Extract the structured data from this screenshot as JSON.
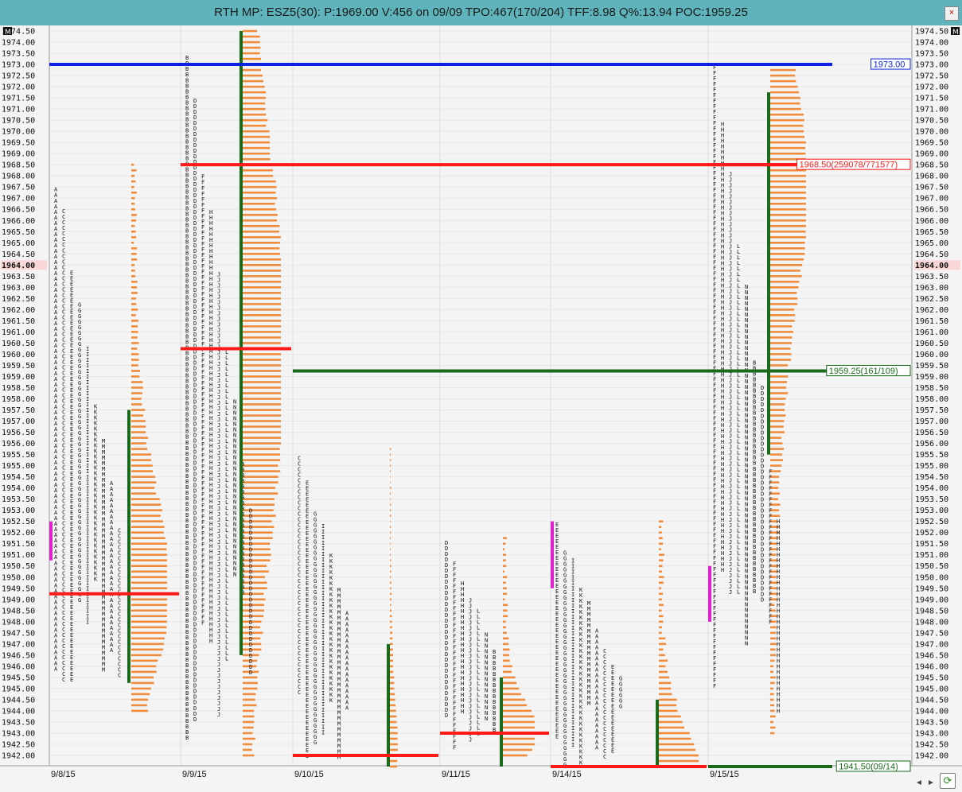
{
  "window": {
    "title": "RTH MP: ESZ5(30): P:1969.00 V:456 on 09/09 TPO:467(170/204) TFF:8.98 Q%:13.94 POC:1959.25",
    "close_label": "×",
    "corner_left": "M",
    "corner_right": "M"
  },
  "colors": {
    "profile": "#f08c3c",
    "poc": "#ff1a1a",
    "value_area": "#1a6a1a",
    "level_line": "#0a24e0",
    "initial_balance": "#dd22cc",
    "highlight_price_bg": "#f9d7d7"
  },
  "chart_data": {
    "type": "market_profile",
    "price_min": 1942.0,
    "price_max": 1974.5,
    "tick_size": 0.5,
    "highlight_price": 1964.0,
    "dates": [
      "9/8/15",
      "9/9/15",
      "9/10/15",
      "9/11/15",
      "9/14/15",
      "9/15/15"
    ],
    "sessions": [
      {
        "date": "9/8/15",
        "tpo_low": 1944.0,
        "tpo_high": 1968.5,
        "poc": 1949.25,
        "va_high": 1957.5,
        "va_low": 1945.25,
        "tpo_letters": [
          "A",
          "B",
          "C",
          "D",
          "E",
          "F",
          "G",
          "H",
          "I",
          "J",
          "K",
          "L",
          "M",
          "N"
        ],
        "ib_low": 1950.75,
        "ib_high": 1952.5
      },
      {
        "date": "9/9/15",
        "tpo_low": 1942.0,
        "tpo_high": 1974.5,
        "poc": 1960.25,
        "va_high": 1974.5,
        "va_low": 1946.5,
        "tpo_letters": [
          "A",
          "B",
          "C",
          "D",
          "E",
          "F",
          "G",
          "H",
          "I",
          "J",
          "K",
          "L",
          "M",
          "N"
        ]
      },
      {
        "date": "9/10/15",
        "tpo_low": 1941.5,
        "tpo_high": 1955.75,
        "poc": 1942.0,
        "va_high": 1947.0,
        "va_low": 1941.5,
        "tpo_letters": [
          "A",
          "B",
          "C",
          "D",
          "E",
          "F",
          "G",
          "H",
          "I",
          "J",
          "K",
          "L",
          "M",
          "N"
        ]
      },
      {
        "date": "9/11/15",
        "tpo_low": 1942.0,
        "tpo_high": 1951.75,
        "poc": 1943.0,
        "va_high": 1945.5,
        "va_low": 1941.5,
        "tpo_letters": [
          "A",
          "B",
          "C",
          "D",
          "E",
          "F",
          "G",
          "H",
          "I",
          "J",
          "K",
          "L",
          "M",
          "N"
        ]
      },
      {
        "date": "9/14/15",
        "tpo_low": 1941.5,
        "tpo_high": 1952.5,
        "poc": 1941.5,
        "va_high": 1944.5,
        "va_low": 1941.5,
        "tpo_letters": [
          "A",
          "B",
          "C",
          "D",
          "E",
          "F",
          "G",
          "H",
          "I",
          "J",
          "K",
          "L",
          "M",
          "N"
        ],
        "ib_low": 1949.5,
        "ib_high": 1952.5
      },
      {
        "date": "9/15/15",
        "tpo_low": 1943.0,
        "tpo_high": 1973.0,
        "poc": 1968.5,
        "va_high": 1971.75,
        "va_low": 1955.5,
        "tpo_letters": [
          "A",
          "B",
          "C",
          "D",
          "E",
          "F",
          "G",
          "H",
          "I",
          "J",
          "K",
          "L",
          "M",
          "N"
        ],
        "ib_low": 1948.0,
        "ib_high": 1950.5
      }
    ],
    "levels": [
      {
        "label": "1973.00",
        "price": 1973.0,
        "color": "#0a24e0"
      },
      {
        "label": "1968.50(259078/771577)",
        "price": 1968.5,
        "color": "#ff1a1a"
      },
      {
        "label": "1959.25(161/109)",
        "price": 1959.25,
        "color": "#1a6a1a"
      },
      {
        "label": "1941.50(09/14)",
        "price": 1941.5,
        "color": "#1a6a1a"
      }
    ]
  }
}
